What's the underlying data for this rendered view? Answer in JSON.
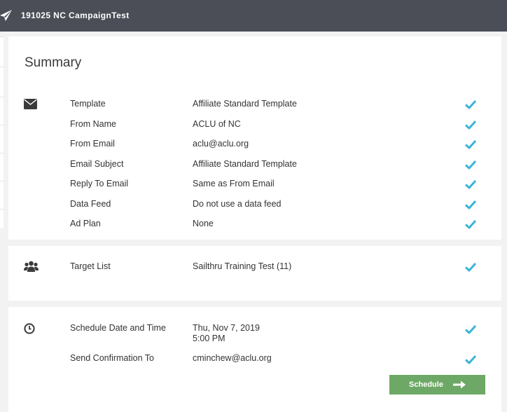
{
  "header": {
    "title": "191025 NC CampaignTest",
    "icon": "paper-plane-icon"
  },
  "summary": {
    "title": "Summary",
    "icon": "envelope-icon",
    "rows": [
      {
        "label": "Template",
        "value": "Affiliate Standard Template"
      },
      {
        "label": "From Name",
        "value": "ACLU of NC"
      },
      {
        "label": "From Email",
        "value": "aclu@aclu.org"
      },
      {
        "label": "Email Subject",
        "value": "Affiliate Standard Template"
      },
      {
        "label": "Reply To Email",
        "value": "Same as From Email"
      },
      {
        "label": "Data Feed",
        "value": "Do not use a data feed"
      },
      {
        "label": "Ad Plan",
        "value": "None"
      }
    ]
  },
  "audience": {
    "icon": "users-icon",
    "rows": [
      {
        "label": "Target List",
        "value": "Sailthru Training Test (11)"
      }
    ]
  },
  "schedule": {
    "icon": "clock-icon",
    "date_label": "Schedule Date and Time",
    "date_value_line1": "Thu, Nov 7, 2019",
    "date_value_line2": "5:00 PM",
    "confirm_label": "Send Confirmation To",
    "confirm_value": "cminchew@aclu.org",
    "button_label": "Schedule"
  },
  "colors": {
    "topbar": "#4b4e57",
    "check": "#3bb3d8",
    "button": "#6ea866"
  }
}
